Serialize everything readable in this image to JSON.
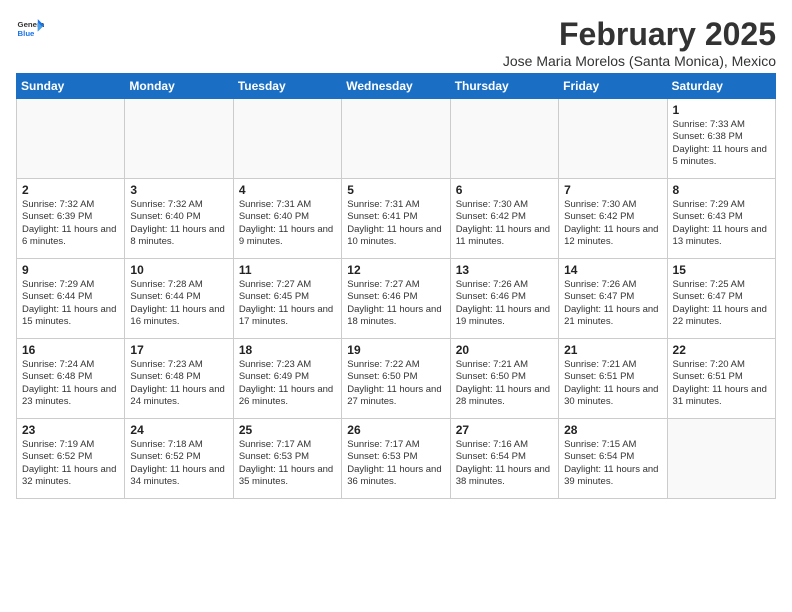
{
  "logo": {
    "line1": "General",
    "line2": "Blue"
  },
  "title": "February 2025",
  "subtitle": "Jose Maria Morelos (Santa Monica), Mexico",
  "days_of_week": [
    "Sunday",
    "Monday",
    "Tuesday",
    "Wednesday",
    "Thursday",
    "Friday",
    "Saturday"
  ],
  "weeks": [
    [
      {
        "day": "",
        "info": ""
      },
      {
        "day": "",
        "info": ""
      },
      {
        "day": "",
        "info": ""
      },
      {
        "day": "",
        "info": ""
      },
      {
        "day": "",
        "info": ""
      },
      {
        "day": "",
        "info": ""
      },
      {
        "day": "1",
        "info": "Sunrise: 7:33 AM\nSunset: 6:38 PM\nDaylight: 11 hours and 5 minutes."
      }
    ],
    [
      {
        "day": "2",
        "info": "Sunrise: 7:32 AM\nSunset: 6:39 PM\nDaylight: 11 hours and 6 minutes."
      },
      {
        "day": "3",
        "info": "Sunrise: 7:32 AM\nSunset: 6:40 PM\nDaylight: 11 hours and 8 minutes."
      },
      {
        "day": "4",
        "info": "Sunrise: 7:31 AM\nSunset: 6:40 PM\nDaylight: 11 hours and 9 minutes."
      },
      {
        "day": "5",
        "info": "Sunrise: 7:31 AM\nSunset: 6:41 PM\nDaylight: 11 hours and 10 minutes."
      },
      {
        "day": "6",
        "info": "Sunrise: 7:30 AM\nSunset: 6:42 PM\nDaylight: 11 hours and 11 minutes."
      },
      {
        "day": "7",
        "info": "Sunrise: 7:30 AM\nSunset: 6:42 PM\nDaylight: 11 hours and 12 minutes."
      },
      {
        "day": "8",
        "info": "Sunrise: 7:29 AM\nSunset: 6:43 PM\nDaylight: 11 hours and 13 minutes."
      }
    ],
    [
      {
        "day": "9",
        "info": "Sunrise: 7:29 AM\nSunset: 6:44 PM\nDaylight: 11 hours and 15 minutes."
      },
      {
        "day": "10",
        "info": "Sunrise: 7:28 AM\nSunset: 6:44 PM\nDaylight: 11 hours and 16 minutes."
      },
      {
        "day": "11",
        "info": "Sunrise: 7:27 AM\nSunset: 6:45 PM\nDaylight: 11 hours and 17 minutes."
      },
      {
        "day": "12",
        "info": "Sunrise: 7:27 AM\nSunset: 6:46 PM\nDaylight: 11 hours and 18 minutes."
      },
      {
        "day": "13",
        "info": "Sunrise: 7:26 AM\nSunset: 6:46 PM\nDaylight: 11 hours and 19 minutes."
      },
      {
        "day": "14",
        "info": "Sunrise: 7:26 AM\nSunset: 6:47 PM\nDaylight: 11 hours and 21 minutes."
      },
      {
        "day": "15",
        "info": "Sunrise: 7:25 AM\nSunset: 6:47 PM\nDaylight: 11 hours and 22 minutes."
      }
    ],
    [
      {
        "day": "16",
        "info": "Sunrise: 7:24 AM\nSunset: 6:48 PM\nDaylight: 11 hours and 23 minutes."
      },
      {
        "day": "17",
        "info": "Sunrise: 7:23 AM\nSunset: 6:48 PM\nDaylight: 11 hours and 24 minutes."
      },
      {
        "day": "18",
        "info": "Sunrise: 7:23 AM\nSunset: 6:49 PM\nDaylight: 11 hours and 26 minutes."
      },
      {
        "day": "19",
        "info": "Sunrise: 7:22 AM\nSunset: 6:50 PM\nDaylight: 11 hours and 27 minutes."
      },
      {
        "day": "20",
        "info": "Sunrise: 7:21 AM\nSunset: 6:50 PM\nDaylight: 11 hours and 28 minutes."
      },
      {
        "day": "21",
        "info": "Sunrise: 7:21 AM\nSunset: 6:51 PM\nDaylight: 11 hours and 30 minutes."
      },
      {
        "day": "22",
        "info": "Sunrise: 7:20 AM\nSunset: 6:51 PM\nDaylight: 11 hours and 31 minutes."
      }
    ],
    [
      {
        "day": "23",
        "info": "Sunrise: 7:19 AM\nSunset: 6:52 PM\nDaylight: 11 hours and 32 minutes."
      },
      {
        "day": "24",
        "info": "Sunrise: 7:18 AM\nSunset: 6:52 PM\nDaylight: 11 hours and 34 minutes."
      },
      {
        "day": "25",
        "info": "Sunrise: 7:17 AM\nSunset: 6:53 PM\nDaylight: 11 hours and 35 minutes."
      },
      {
        "day": "26",
        "info": "Sunrise: 7:17 AM\nSunset: 6:53 PM\nDaylight: 11 hours and 36 minutes."
      },
      {
        "day": "27",
        "info": "Sunrise: 7:16 AM\nSunset: 6:54 PM\nDaylight: 11 hours and 38 minutes."
      },
      {
        "day": "28",
        "info": "Sunrise: 7:15 AM\nSunset: 6:54 PM\nDaylight: 11 hours and 39 minutes."
      },
      {
        "day": "",
        "info": ""
      }
    ]
  ]
}
